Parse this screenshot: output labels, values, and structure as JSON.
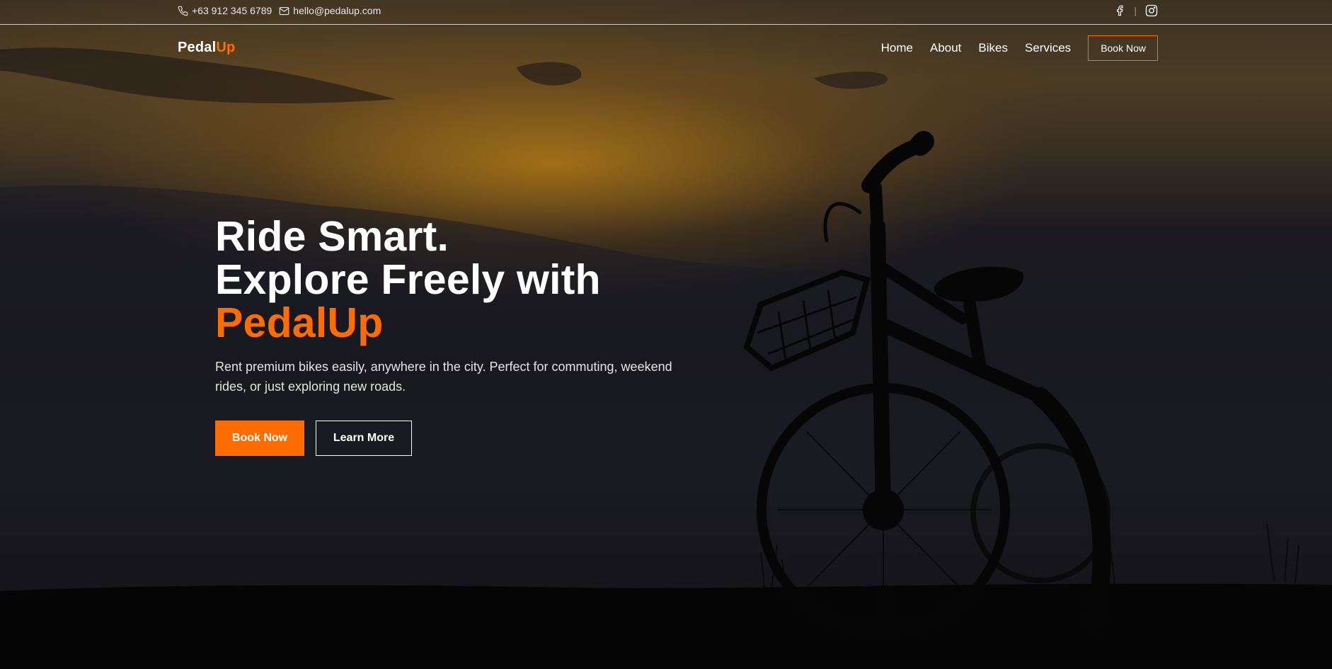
{
  "topbar": {
    "phone": "+63 912 345 6789",
    "email": "hello@pedalup.com",
    "social": [
      "facebook-icon",
      "instagram-icon"
    ]
  },
  "brand": {
    "name": "Pedal",
    "accent": "Up"
  },
  "nav": {
    "links": [
      "Home",
      "About",
      "Bikes",
      "Services"
    ],
    "cta": "Book Now"
  },
  "hero": {
    "line1": "Ride Smart.",
    "line2": "Explore Freely with",
    "line3": "PedalUp",
    "description": "Rent premium bikes easily, anywhere in the city. Perfect for commuting, weekend rides, or just exploring new roads.",
    "primary_cta": "Book Now",
    "secondary_cta": "Learn More"
  },
  "colors": {
    "accent": "#ff6d00",
    "text": "#ffffff",
    "background": "#0b0b0d"
  }
}
